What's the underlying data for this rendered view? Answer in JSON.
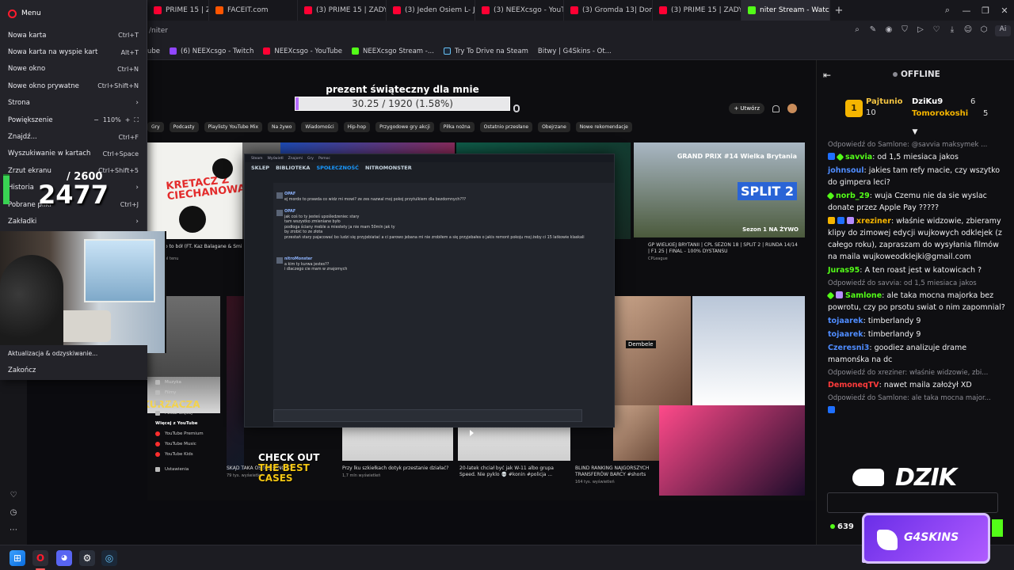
{
  "tabs": [
    {
      "label": "PRIME 15 | ZADYMA",
      "favicon": "youtube-favicon"
    },
    {
      "label": "FACEIT.com",
      "favicon": "faceit-favicon"
    },
    {
      "label": "(3) PRIME 15 | ZADYMA",
      "favicon": "youtube-favicon"
    },
    {
      "label": "(3) Jeden Osiem L- Jak Zap",
      "favicon": "youtube-favicon"
    },
    {
      "label": "(3) NEEXcsgo - YouTube",
      "favicon": "youtube-favicon"
    },
    {
      "label": "(3) Gromda 13| Dominik A",
      "favicon": "youtube-favicon"
    },
    {
      "label": "(3) PRIME 15 | ZADYMA",
      "favicon": "youtube-favicon"
    },
    {
      "label": "niter Stream - Watch l",
      "favicon": "kick-favicon",
      "active": true
    }
  ],
  "new_tab_label": "+",
  "address": {
    "url": "/niter"
  },
  "bookmarks": [
    {
      "label": "ube",
      "favicon": "youtube-favicon"
    },
    {
      "label": "(6) NEEXcsgo - Twitch",
      "favicon": "twitch-favicon"
    },
    {
      "label": "NEEXcsgo - YouTube",
      "favicon": "youtube-favicon"
    },
    {
      "label": "NEEXcsgo Stream -...",
      "favicon": "kick-favicon"
    },
    {
      "label": "Try To Drive na Steam",
      "favicon": "steam-favicon"
    },
    {
      "label": "Bitwy | G4Skins - Ot...",
      "favicon": "g4skins-favicon"
    }
  ],
  "menu": {
    "title": "Menu",
    "items": [
      {
        "label": "Nowa karta",
        "shortcut": "Ctrl+T"
      },
      {
        "label": "Nowa karta na wyspie kart",
        "shortcut": "Alt+T"
      },
      {
        "label": "Nowe okno",
        "shortcut": "Ctrl+N"
      },
      {
        "label": "Nowe okno prywatne",
        "shortcut": "Ctrl+Shift+N"
      },
      {
        "label": "Strona",
        "shortcut": "›"
      },
      {
        "label": "Powiększenie",
        "shortcut": ""
      },
      {
        "label": "Znajdź...",
        "shortcut": "Ctrl+F"
      },
      {
        "label": "Wyszukiwanie w kartach",
        "shortcut": "Ctrl+Space"
      },
      {
        "label": "Zrzut ekranu",
        "shortcut": "Ctrl+Shift+5"
      },
      {
        "label": "Historia",
        "shortcut": "›"
      },
      {
        "label": "Pobrane pliki",
        "shortcut": "Ctrl+J"
      },
      {
        "label": "Zakładki",
        "shortcut": "›"
      }
    ],
    "zoom": {
      "minus": "−",
      "value": "110%",
      "plus": "+",
      "fullscreen": "⛶"
    },
    "lower_items": [
      {
        "label": "Aktualizacja & odzyskiwanie..."
      },
      {
        "label": "Zakończ"
      }
    ]
  },
  "stat_overlay": {
    "current": "2477",
    "max": "/ 2600",
    "fill_fraction": 0.95
  },
  "stream": {
    "goal_title": "prezent świąteczny dla mnie",
    "goal_text": "30.25 / 1920 (1.58%)",
    "goal_fraction": 0.0158,
    "yt_create": "+ Utwórz",
    "chips": [
      "Gry",
      "Podcasty",
      "Playlisty YouTube Mix",
      "Na żywo",
      "Wiadomości",
      "Hip-hop",
      "Przygodowe gry akcji",
      "Piłka nożna",
      "Ostatnio przesłane",
      "Obejrzane",
      "Nowe rekomendacje"
    ],
    "thumb_texts": {
      "kretacz": "KRETACZ Z CIECHANOWA",
      "gp_title": "GRAND PRIX #14 Wielka Brytania",
      "split": "SPLIT 2",
      "season": "Sezon 1 NA ŻYWO",
      "odkurzacza": "ODKURZACZA",
      "dembele": "Dembele",
      "promo_line1": "CHECK OUT",
      "promo_line2": "THE BEST",
      "promo_line3": "CASES"
    },
    "video_titles": [
      {
        "title": "o to bół (FT. Kaz Balagane & Smi",
        "meta": "ol tenu"
      },
      {
        "title": "GP WIELKIEJ BRYTANII | CPL SEZON 18 | SPLIT 2 | RUNDA 14/14 | F1 25 | FINAL - 100% DYSTANSU",
        "meta": "CPLeague"
      },
      {
        "title": "SKĄD TAKA OSZCZĘDNOŚĆ?",
        "meta": "79 tys. wyświetleń"
      },
      {
        "title": "Przy lku szkiełkach dotyk przestanie działać?",
        "meta": "1,7 mln wyświetleń"
      },
      {
        "title": "20-latek chciał być jak W-11 albo grupa Speed. Nie pyklo 💀 #konin #policja ...",
        "meta": ""
      },
      {
        "title": "BLIND RANKING NAJGORSZYCH TRANSFERÓW BARCY #shorts",
        "meta": "164 tys. wyświetleń"
      }
    ],
    "yt_sidebar": [
      "Muzyka",
      "Filmy",
      "Na żywo",
      "Pokaż więcej",
      "Więcej z YouTube",
      "YouTube Premium",
      "YouTube Music",
      "YouTube Kids",
      "Ustawienia"
    ],
    "steam": {
      "topbar": [
        "Steam",
        "Wyświetl",
        "Znajomi",
        "Gry",
        "Pomoc"
      ],
      "nav": [
        "SKLEP",
        "BIBLIOTEKA",
        "SPOŁECZNOŚĆ",
        "NITROMONSTER"
      ],
      "chat_title": "OPAF",
      "messages": [
        {
          "who": "OPAF",
          "text": "ej mordo to prawda co widz mi mowi? ze zes nazwal moj pokoj przytulkiem dla bezdomnych???"
        },
        {
          "who": "OPAF",
          "text": "jak coś to ty jesteś upośledzeniec stary\ntam wszystko zmieniane było\npodłoga ściany meble a miestety ja nie mam 50mln jak ty\nby zrobić to ze złota\nprzestań stary pajacować bo ludzi się przyjebiatać a ci parowo jebana mi nie zrobiłem a się przyjebałes o jakis remont pokoju moj żeby ci 15 latkowie klaskali"
        },
        {
          "who": "nitroMonster",
          "text": "a kim ty kurwa jestes??\ni dlaczego cie mam w znajomych"
        }
      ]
    }
  },
  "chat": {
    "status": "OFFLINE",
    "leaderboard": [
      {
        "rank": "1",
        "name": "Pajtunio",
        "value": "10"
      },
      {
        "name": "DziKu9",
        "value": "6"
      },
      {
        "name": "Tomorokoshi",
        "value": "5"
      }
    ],
    "messages": [
      {
        "reply": "Odpowiedź do Samlone: @savvia maksymek ...",
        "user": "savvia",
        "color": "#53fc18",
        "text": "od 1,5 miesiaca jakos"
      },
      {
        "user": "johnsoul",
        "color": "#4f8cff",
        "text": "jakies tam refy macie, czy wszytko do gimpera leci?"
      },
      {
        "user": "norb_29",
        "color": "#53fc18",
        "text": "wuja Czemu nie da sie wyslac donate przez Apple Pay ?????"
      },
      {
        "user": "xreziner",
        "color": "#f5b500",
        "text": "właśnie widzowie, zbieramy klipy do zimowej edycji wujkowych odklejek (z całego roku), zapraszam do wysyłania filmów na maila wujkoweodklejki@gmail.com"
      },
      {
        "user": "Juras95",
        "color": "#53fc18",
        "text": "A ten roast jest w katowicach ?"
      },
      {
        "reply": "Odpowiedź do savvia: od 1,5 miesiaca jakos",
        "user": "Samlone",
        "color": "#53fc18",
        "text": "ale taka mocna majorka bez powrotu, czy po prsotu swiat o nim zapomnial?"
      },
      {
        "user": "tojaarek",
        "color": "#4f8cff",
        "text": "timberlandy 9"
      },
      {
        "user": "tojaarek",
        "color": "#4f8cff",
        "text": "timberlandy 9"
      },
      {
        "user": "Czeresni3",
        "color": "#4f8cff",
        "text": "goodiez analizuje drame mamonśka na dc"
      },
      {
        "reply": "Odpowiedź do xreziner: właśnie widzowie, zbi...",
        "user": "DemoneqTV",
        "color": "#ff3b3b",
        "text": "nawet maila założył XD"
      },
      {
        "reply": "Odpowiedź do Samlone: ale taka mocna major...",
        "user": "",
        "color": "#4f8cff",
        "text": ""
      }
    ],
    "points": "639",
    "sponsor_dzik": "DZIK",
    "sponsor_g4": "G4SKINS"
  },
  "taskbar": [
    "windows-start",
    "opera",
    "discord",
    "steam-helper",
    "steam"
  ]
}
